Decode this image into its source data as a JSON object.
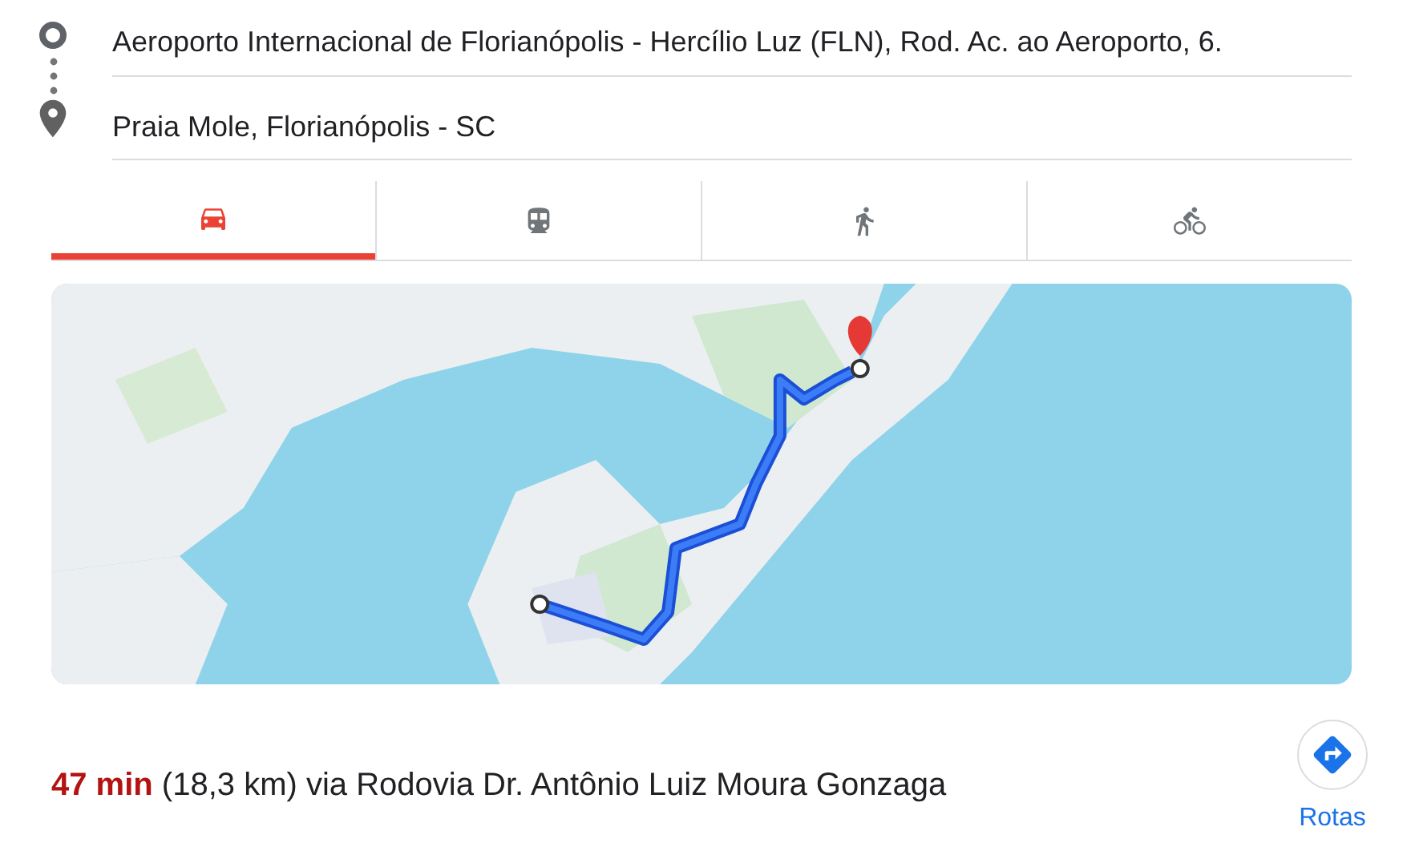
{
  "origin": {
    "value": "Aeroporto Internacional de Florianópolis - Hercílio Luz (FLN), Rod. Ac. ao Aeroporto, 6."
  },
  "destination": {
    "value": "Praia Mole, Florianópolis - SC"
  },
  "modes": [
    {
      "kind": "car",
      "selected": true
    },
    {
      "kind": "transit",
      "selected": false
    },
    {
      "kind": "walk",
      "selected": false
    },
    {
      "kind": "bike",
      "selected": false
    }
  ],
  "summary": {
    "duration": "47 min",
    "details": "(18,3 km) via Rodovia Dr. Antônio Luiz Moura Gonzaga"
  },
  "directions_button": {
    "label": "Rotas"
  }
}
